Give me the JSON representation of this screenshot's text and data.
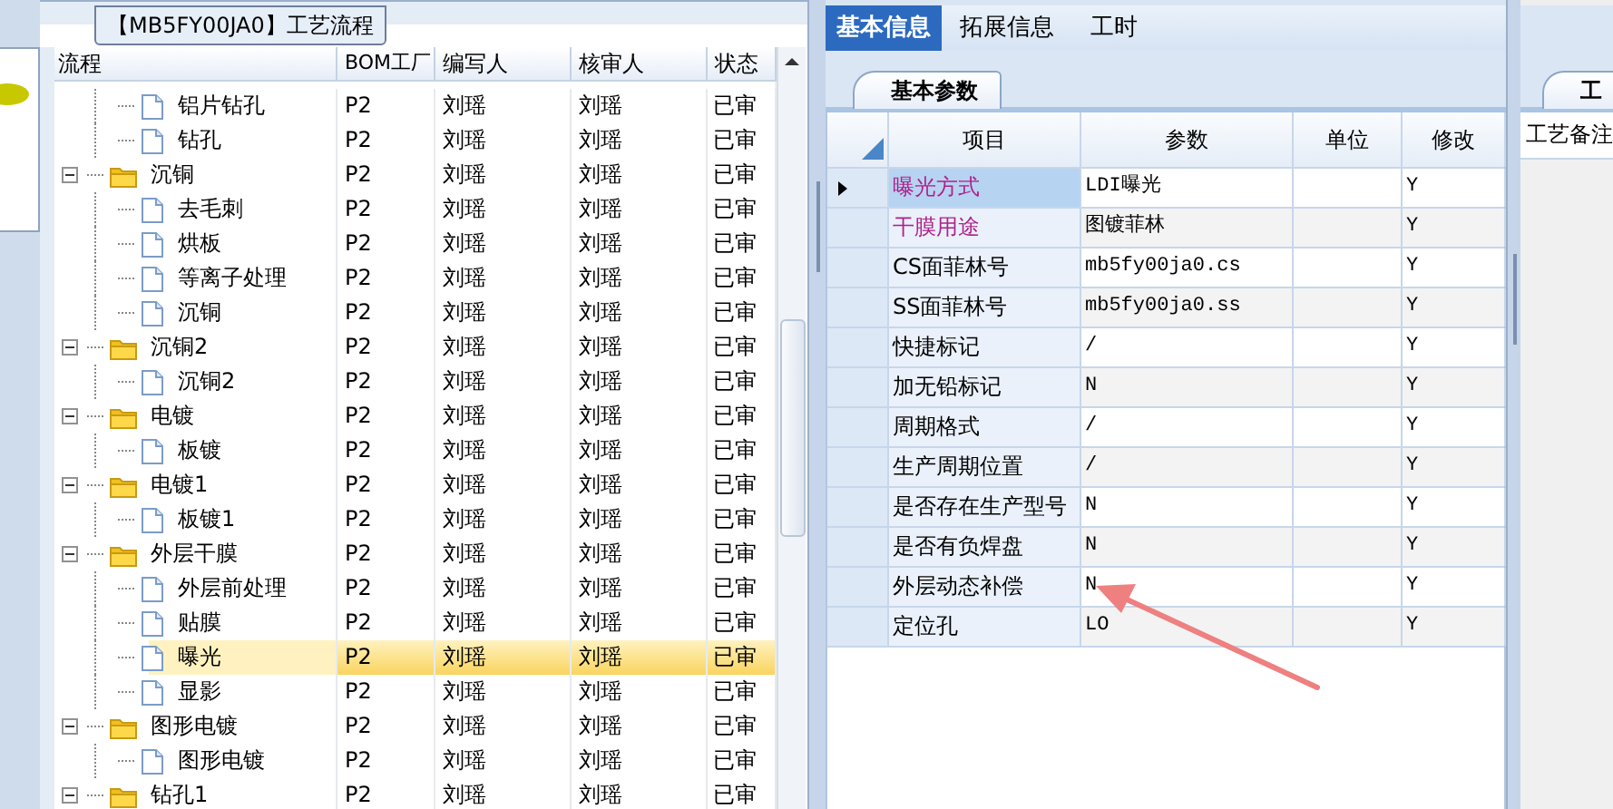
{
  "left_panel": {
    "title": "【MB5FY00JA0】工艺流程",
    "tree": {
      "columns": [
        "流程",
        "BOM工厂",
        "编写人",
        "核审人",
        "状态"
      ],
      "rows": [
        {
          "kind": "cut",
          "children": [
            {
              "kind": "leaf",
              "label": "铝片钻孔",
              "bom": "P2",
              "writer": "刘瑶",
              "reviewer": "刘瑶",
              "status": "已审",
              "selected": false
            },
            {
              "kind": "leaf",
              "label": "钻孔",
              "bom": "P2",
              "writer": "刘瑶",
              "reviewer": "刘瑶",
              "status": "已审",
              "selected": false
            }
          ]
        },
        {
          "kind": "folder",
          "label": "沉铜",
          "expanded": true,
          "bom": "P2",
          "writer": "刘瑶",
          "reviewer": "刘瑶",
          "status": "已审",
          "selected": false,
          "children": [
            {
              "kind": "leaf",
              "label": "去毛刺",
              "bom": "P2",
              "writer": "刘瑶",
              "reviewer": "刘瑶",
              "status": "已审",
              "selected": false
            },
            {
              "kind": "leaf",
              "label": "烘板",
              "bom": "P2",
              "writer": "刘瑶",
              "reviewer": "刘瑶",
              "status": "已审",
              "selected": false
            },
            {
              "kind": "leaf",
              "label": "等离子处理",
              "bom": "P2",
              "writer": "刘瑶",
              "reviewer": "刘瑶",
              "status": "已审",
              "selected": false
            },
            {
              "kind": "leaf",
              "label": "沉铜",
              "bom": "P2",
              "writer": "刘瑶",
              "reviewer": "刘瑶",
              "status": "已审",
              "selected": false
            }
          ]
        },
        {
          "kind": "folder",
          "label": "沉铜2",
          "expanded": true,
          "bom": "P2",
          "writer": "刘瑶",
          "reviewer": "刘瑶",
          "status": "已审",
          "selected": false,
          "children": [
            {
              "kind": "leaf",
              "label": "沉铜2",
              "bom": "P2",
              "writer": "刘瑶",
              "reviewer": "刘瑶",
              "status": "已审",
              "selected": false
            }
          ]
        },
        {
          "kind": "folder",
          "label": "电镀",
          "expanded": true,
          "bom": "P2",
          "writer": "刘瑶",
          "reviewer": "刘瑶",
          "status": "已审",
          "selected": false,
          "children": [
            {
              "kind": "leaf",
              "label": "板镀",
              "bom": "P2",
              "writer": "刘瑶",
              "reviewer": "刘瑶",
              "status": "已审",
              "selected": false
            }
          ]
        },
        {
          "kind": "folder",
          "label": "电镀1",
          "expanded": true,
          "bom": "P2",
          "writer": "刘瑶",
          "reviewer": "刘瑶",
          "status": "已审",
          "selected": false,
          "children": [
            {
              "kind": "leaf",
              "label": "板镀1",
              "bom": "P2",
              "writer": "刘瑶",
              "reviewer": "刘瑶",
              "status": "已审",
              "selected": false
            }
          ]
        },
        {
          "kind": "folder",
          "label": "外层干膜",
          "expanded": true,
          "bom": "P2",
          "writer": "刘瑶",
          "reviewer": "刘瑶",
          "status": "已审",
          "selected": false,
          "children": [
            {
              "kind": "leaf",
              "label": "外层前处理",
              "bom": "P2",
              "writer": "刘瑶",
              "reviewer": "刘瑶",
              "status": "已审",
              "selected": false
            },
            {
              "kind": "leaf",
              "label": "贴膜",
              "bom": "P2",
              "writer": "刘瑶",
              "reviewer": "刘瑶",
              "status": "已审",
              "selected": false
            },
            {
              "kind": "leaf",
              "label": "曝光",
              "bom": "P2",
              "writer": "刘瑶",
              "reviewer": "刘瑶",
              "status": "已审",
              "selected": true
            },
            {
              "kind": "leaf",
              "label": "显影",
              "bom": "P2",
              "writer": "刘瑶",
              "reviewer": "刘瑶",
              "status": "已审",
              "selected": false
            }
          ]
        },
        {
          "kind": "folder",
          "label": "图形电镀",
          "expanded": true,
          "bom": "P2",
          "writer": "刘瑶",
          "reviewer": "刘瑶",
          "status": "已审",
          "selected": false,
          "children": [
            {
              "kind": "leaf",
              "label": "图形电镀",
              "bom": "P2",
              "writer": "刘瑶",
              "reviewer": "刘瑶",
              "status": "已审",
              "selected": false
            }
          ]
        },
        {
          "kind": "folder",
          "label": "钻孔1",
          "expanded": true,
          "bom": "P2",
          "writer": "刘瑶",
          "reviewer": "刘瑶",
          "status": "已审",
          "selected": false
        }
      ]
    }
  },
  "right_panel": {
    "tabs": [
      {
        "label": "基本信息",
        "selected": true
      },
      {
        "label": "拓展信息",
        "selected": false
      },
      {
        "label": "工时",
        "selected": false
      }
    ],
    "subtab": "基本参数",
    "grid": {
      "columns": [
        "项目",
        "参数",
        "单位",
        "修改"
      ],
      "rows": [
        {
          "item": "曝光方式",
          "value": "LDI曝光",
          "editable": "Y",
          "emphasized": true,
          "selected": true
        },
        {
          "item": "干膜用途",
          "value": "图镀菲林",
          "editable": "Y",
          "emphasized": true,
          "selected": false
        },
        {
          "item": "CS面菲林号",
          "value": "mb5fy00ja0.cs",
          "editable": "Y",
          "emphasized": false,
          "selected": false
        },
        {
          "item": "SS面菲林号",
          "value": "mb5fy00ja0.ss",
          "editable": "Y",
          "emphasized": false,
          "selected": false
        },
        {
          "item": "快捷标记",
          "value": "/",
          "editable": "Y",
          "emphasized": false,
          "selected": false
        },
        {
          "item": "加无铅标记",
          "value": "N",
          "editable": "Y",
          "emphasized": false,
          "selected": false
        },
        {
          "item": "周期格式",
          "value": "/",
          "editable": "Y",
          "emphasized": false,
          "selected": false
        },
        {
          "item": "生产周期位置",
          "value": "/",
          "editable": "Y",
          "emphasized": false,
          "selected": false
        },
        {
          "item": "是否存在生产型号",
          "value": "N",
          "editable": "Y",
          "emphasized": false,
          "selected": false
        },
        {
          "item": "是否有负焊盘",
          "value": "N",
          "editable": "Y",
          "emphasized": false,
          "selected": false
        },
        {
          "item": "外层动态补偿",
          "value": "N",
          "editable": "Y",
          "emphasized": false,
          "selected": false
        },
        {
          "item": "定位孔",
          "value": "LO",
          "editable": "Y",
          "emphasized": false,
          "selected": false
        }
      ]
    }
  },
  "side_panel": {
    "tab": "工",
    "label": "工艺备注"
  }
}
